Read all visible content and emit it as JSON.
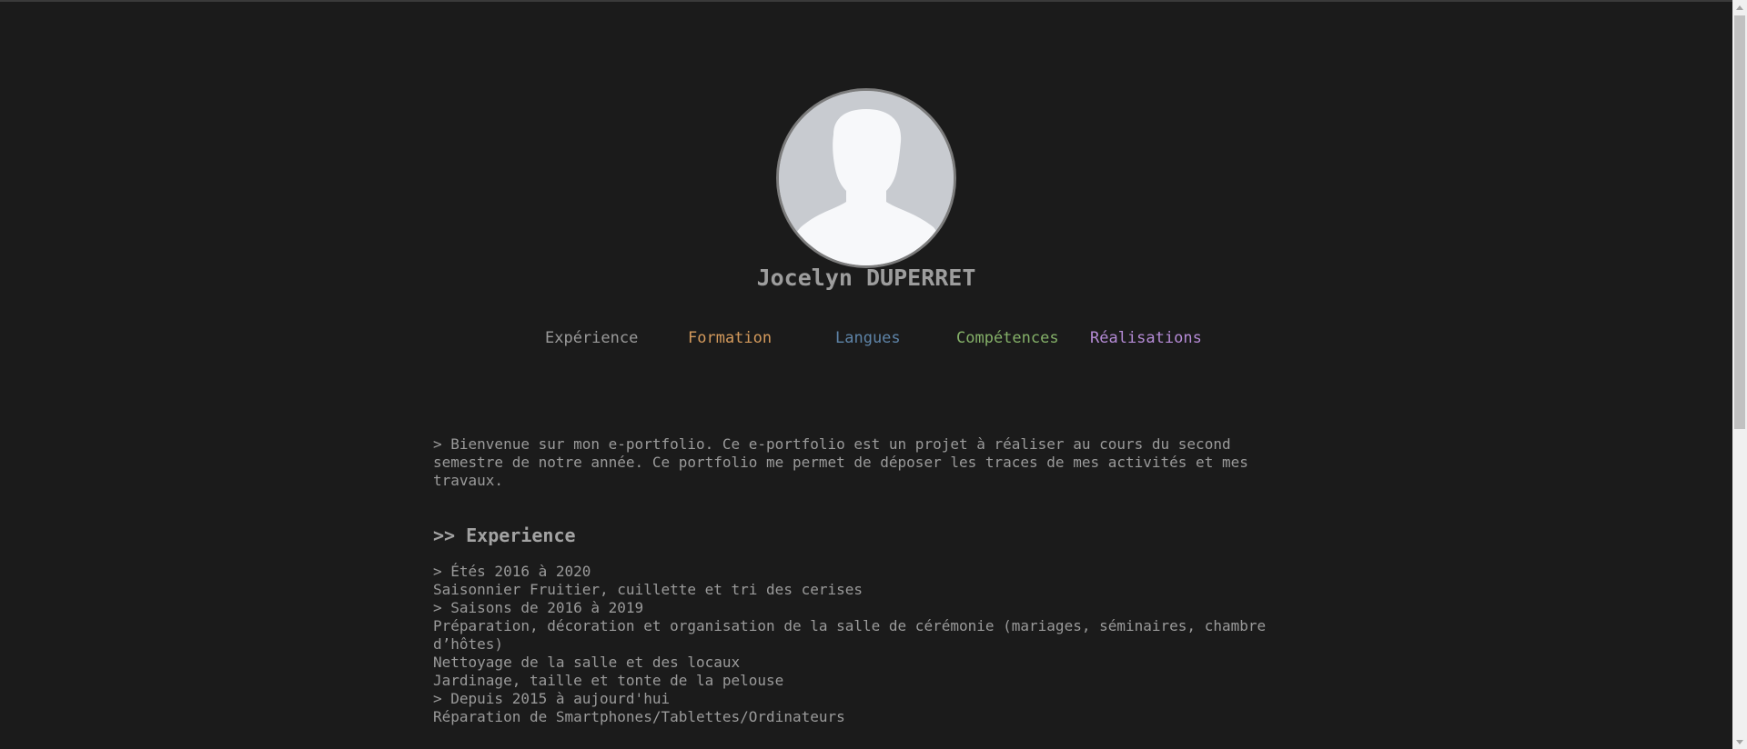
{
  "profile": {
    "name": "Jocelyn DUPERRET"
  },
  "nav": [
    {
      "label": "Expérience",
      "color": "#9a9a9a"
    },
    {
      "label": "Formation",
      "color": "#d49a5c"
    },
    {
      "label": "Langues",
      "color": "#5e84a8"
    },
    {
      "label": "Compétences",
      "color": "#84b068"
    },
    {
      "label": "Réalisations",
      "color": "#b58bd6"
    }
  ],
  "intro": "> Bienvenue sur mon e-portfolio. Ce e-portfolio est un projet à réaliser au cours du second semestre de notre année. Ce portfolio me permet de déposer les traces de mes activités et mes travaux.",
  "experience": {
    "title": ">> Experience",
    "lines": [
      "> Étés 2016 à 2020",
      "Saisonnier Fruitier, cuillette et tri des cerises",
      "> Saisons de 2016 à 2019",
      "Préparation, décoration et organisation de la salle de cérémonie (mariages, séminaires, chambre d’hôtes)",
      "Nettoyage de la salle et des locaux",
      "Jardinage, taille et tonte de la pelouse",
      "> Depuis 2015 à aujourd'hui",
      "Réparation de Smartphones/Tablettes/Ordinateurs"
    ]
  }
}
